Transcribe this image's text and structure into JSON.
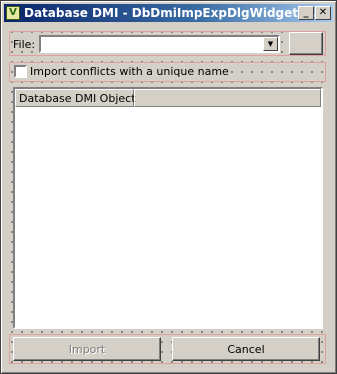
{
  "window": {
    "title": "Database DMI  - DbDmiImpExpDlgWidgets.ui",
    "app_icon": "V"
  },
  "title_buttons": {
    "minimize_glyph": "_",
    "close_glyph": "✕"
  },
  "file_row": {
    "label": "File:",
    "value": "",
    "dropdown_glyph": "▼",
    "browse_label": ""
  },
  "options": {
    "import_conflicts_label": "Import conflicts with a unique name",
    "import_conflicts_checked": false
  },
  "list": {
    "columns": [
      "Database DMI Object",
      ""
    ],
    "rows": []
  },
  "buttons": {
    "import_label": "Import",
    "import_enabled": false,
    "cancel_label": "Cancel"
  }
}
